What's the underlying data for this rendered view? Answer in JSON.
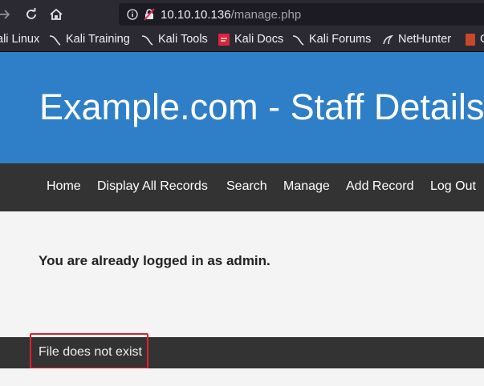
{
  "browser": {
    "url_host": "10.10.10.136",
    "url_path": "/manage.php",
    "bookmarks": [
      {
        "label": "ali Linux",
        "icon": "kali-dragon-icon"
      },
      {
        "label": "Kali Training",
        "icon": "kali-dragon-icon"
      },
      {
        "label": "Kali Tools",
        "icon": "kali-dragon-icon"
      },
      {
        "label": "Kali Docs",
        "icon": "kali-docs-icon"
      },
      {
        "label": "Kali Forums",
        "icon": "kali-dragon-icon"
      },
      {
        "label": "NetHunter",
        "icon": "nethunter-icon"
      },
      {
        "label": "G",
        "icon": "offsec-icon"
      }
    ]
  },
  "site": {
    "title": "Example.com - Staff Details"
  },
  "menu": {
    "items": [
      "Home",
      "Display All Records",
      "Search",
      "Manage",
      "Add Record",
      "Log Out"
    ]
  },
  "main": {
    "message": "You are already logged in as admin."
  },
  "footer": {
    "message": "File does not exist"
  },
  "colors": {
    "hero_bg": "#2f7fc8",
    "menu_bg": "#333333",
    "highlight": "#e0212a"
  }
}
